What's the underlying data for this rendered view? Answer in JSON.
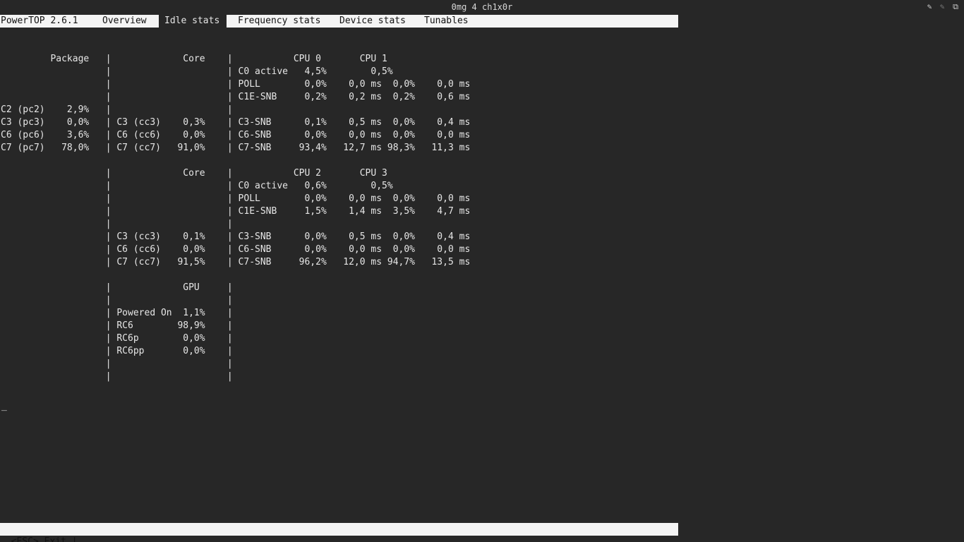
{
  "window": {
    "title": "0mg 4 ch1x0r"
  },
  "header": {
    "app_version": "PowerTOP 2.6.1",
    "tabs": [
      {
        "label": "Overview",
        "active": false
      },
      {
        "label": "Idle stats",
        "active": true
      },
      {
        "label": "Frequency stats",
        "active": false
      },
      {
        "label": "Device stats",
        "active": false
      },
      {
        "label": "Tunables",
        "active": false
      }
    ]
  },
  "idle_stats": {
    "lines": [
      "         Package   |             Core    |           CPU 0       CPU 1",
      "                   |                     | C0 active   4,5%        0,5%",
      "                   |                     | POLL        0,0%    0,0 ms  0,0%    0,0 ms",
      "                   |                     | C1E-SNB     0,2%    0,2 ms  0,2%    0,6 ms",
      "C2 (pc2)    2,9%   |                     |",
      "C3 (pc3)    0,0%   | C3 (cc3)    0,3%    | C3-SNB      0,1%    0,5 ms  0,0%    0,4 ms",
      "C6 (pc6)    3,6%   | C6 (cc6)    0,0%    | C6-SNB      0,0%    0,0 ms  0,0%    0,0 ms",
      "C7 (pc7)   78,0%   | C7 (cc7)   91,0%    | C7-SNB     93,4%   12,7 ms 98,3%   11,3 ms",
      "",
      "                   |             Core    |           CPU 2       CPU 3",
      "                   |                     | C0 active   0,6%        0,5%",
      "                   |                     | POLL        0,0%    0,0 ms  0,0%    0,0 ms",
      "                   |                     | C1E-SNB     1,5%    1,4 ms  3,5%    4,7 ms",
      "                   |                     |",
      "                   | C3 (cc3)    0,1%    | C3-SNB      0,0%    0,5 ms  0,0%    0,4 ms",
      "                   | C6 (cc6)    0,0%    | C6-SNB      0,0%    0,0 ms  0,0%    0,0 ms",
      "                   | C7 (cc7)   91,5%    | C7-SNB     96,2%   12,0 ms 94,7%   13,5 ms",
      "",
      "                   |             GPU     |",
      "                   |                     |",
      "                   | Powered On  1,1%    |",
      "                   | RC6        98,9%    |",
      "                   | RC6p        0,0%    |",
      "                   | RC6pp       0,0%    |",
      "                   |                     |",
      "                   |                     |"
    ]
  },
  "cursor": "_",
  "footer": {
    "status": "<ESC> Exit |"
  },
  "icons": {
    "left": "pencil-icon",
    "middle": "pencil-dim-icon",
    "right": "restore-icon"
  }
}
